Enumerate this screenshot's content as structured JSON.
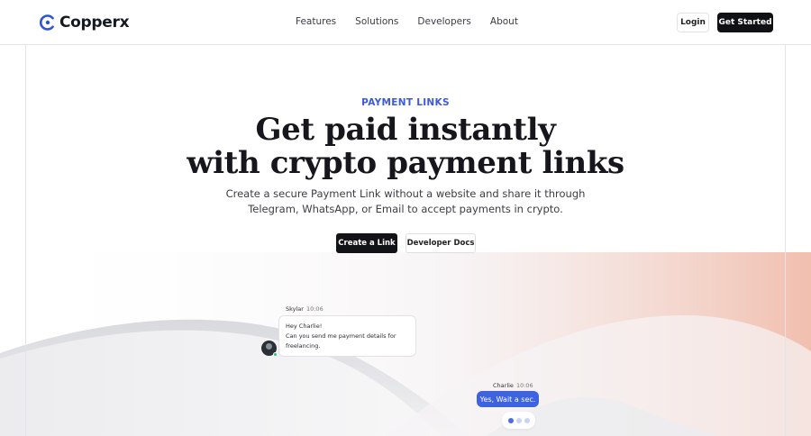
{
  "brand": {
    "name": "Copperx",
    "logo_icon": "copperx-c-logo-icon",
    "color": "#2c54d6"
  },
  "nav": {
    "items": [
      {
        "label": "Features"
      },
      {
        "label": "Solutions"
      },
      {
        "label": "Developers"
      },
      {
        "label": "About"
      }
    ],
    "login_label": "Login",
    "get_started_label": "Get Started"
  },
  "hero": {
    "eyebrow": "PAYMENT LINKS",
    "headline_line1": "Get paid instantly",
    "headline_line2": "with crypto payment links",
    "subtitle_line1": "Create a secure Payment Link without a website and share it through",
    "subtitle_line2": "Telegram, WhatsApp, or Email to accept payments in crypto.",
    "primary_cta": "Create a Link",
    "secondary_cta": "Developer Docs",
    "accent_color": "#3b5bdb"
  },
  "chat": {
    "incoming": {
      "sender": "Skylar",
      "time": "10:06",
      "lines": [
        "Hey Charlie!",
        "Can you send me payment details for",
        "freelancing."
      ]
    },
    "outgoing": {
      "sender": "Charlie",
      "time": "10:06",
      "text": "Yes, Wait a sec."
    },
    "bubble_color": "#3d63e0"
  }
}
